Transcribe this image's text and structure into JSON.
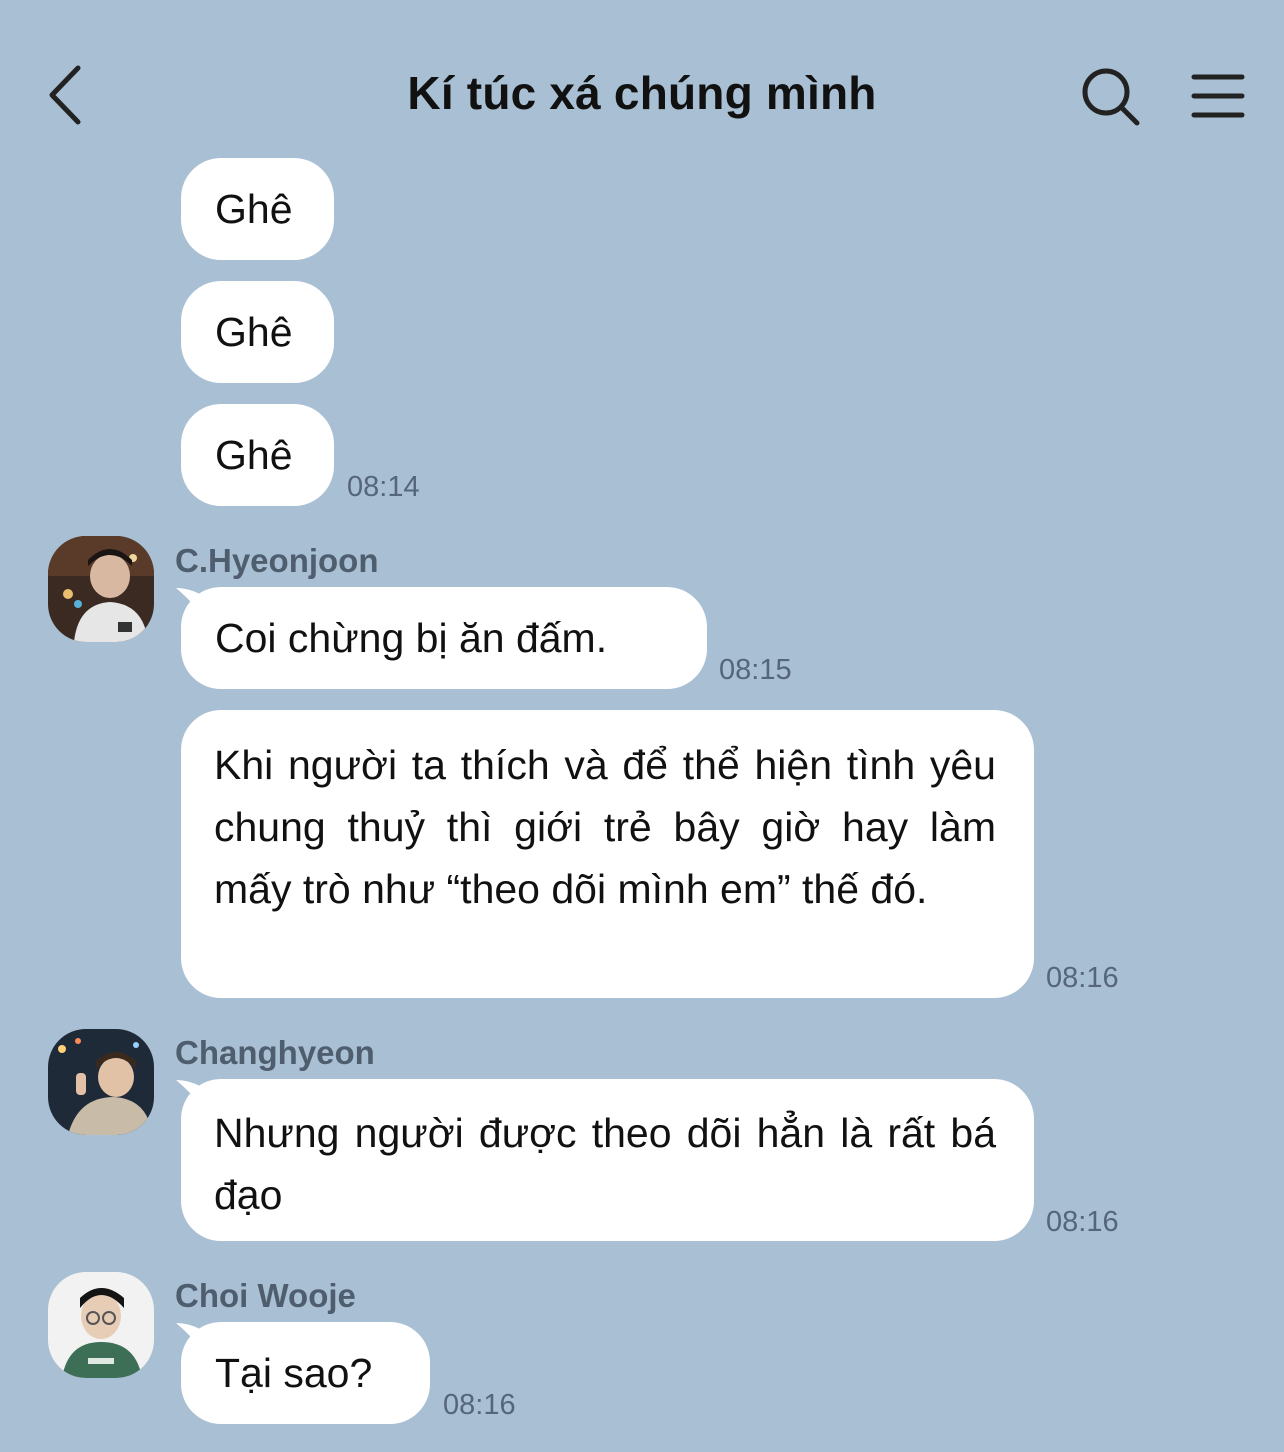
{
  "header": {
    "title": "Kí túc xá chúng mình",
    "back_icon": "chevron-left-icon",
    "search_icon": "search-icon",
    "menu_icon": "hamburger-menu-icon"
  },
  "messages": [
    {
      "sender": "",
      "text": "Ghê",
      "time": ""
    },
    {
      "sender": "",
      "text": "Ghê",
      "time": ""
    },
    {
      "sender": "",
      "text": "Ghê",
      "time": "08:14"
    },
    {
      "sender": "C.Hyeonjoon",
      "text": "Coi chừng bị ăn đấm.",
      "time": "08:15"
    },
    {
      "sender": "",
      "text": "Khi người ta thích và để thể hiện tình yêu chung thuỷ thì giới trẻ bây giờ hay làm mấy trò như “theo dõi mình em” thế đó.",
      "time": "08:16"
    },
    {
      "sender": "Changhyeon",
      "text": "Nhưng người được theo dõi hẳn là rất bá đạo",
      "time": "08:16"
    },
    {
      "sender": "Choi Wooje",
      "text": "Tại sao?",
      "time": "08:16"
    }
  ]
}
